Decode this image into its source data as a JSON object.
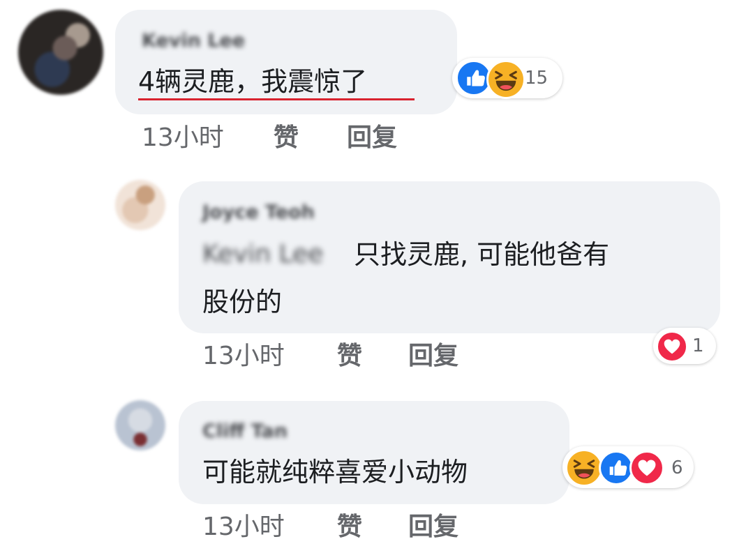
{
  "comments": [
    {
      "author": "Kevin Lee",
      "text": "4辆灵鹿，我震惊了",
      "time": "13小时",
      "like_label": "赞",
      "reply_label": "回复",
      "reaction_count": "15",
      "reactions": [
        "like-icon",
        "haha-icon"
      ]
    },
    {
      "author": "Joyce Teoh",
      "mention": "Kevin Lee",
      "text_line1": "只找灵鹿, 可能他爸有",
      "text_line2": "股份的",
      "time": "13小时",
      "like_label": "赞",
      "reply_label": "回复",
      "reaction_count": "1",
      "reactions": [
        "love-icon"
      ]
    },
    {
      "author": "Cliff Tan",
      "text": "可能就纯粹喜爱小动物",
      "time": "13小时",
      "like_label": "赞",
      "reply_label": "回复",
      "reaction_count": "6",
      "reactions": [
        "haha-icon",
        "like-icon",
        "love-icon"
      ]
    }
  ],
  "colors": {
    "bubble": "#f0f2f5",
    "like_blue": "#1877f2",
    "love_red": "#f02849",
    "haha_yellow": "#f7b125",
    "underline": "#d8222e",
    "meta_gray": "#65676b"
  }
}
